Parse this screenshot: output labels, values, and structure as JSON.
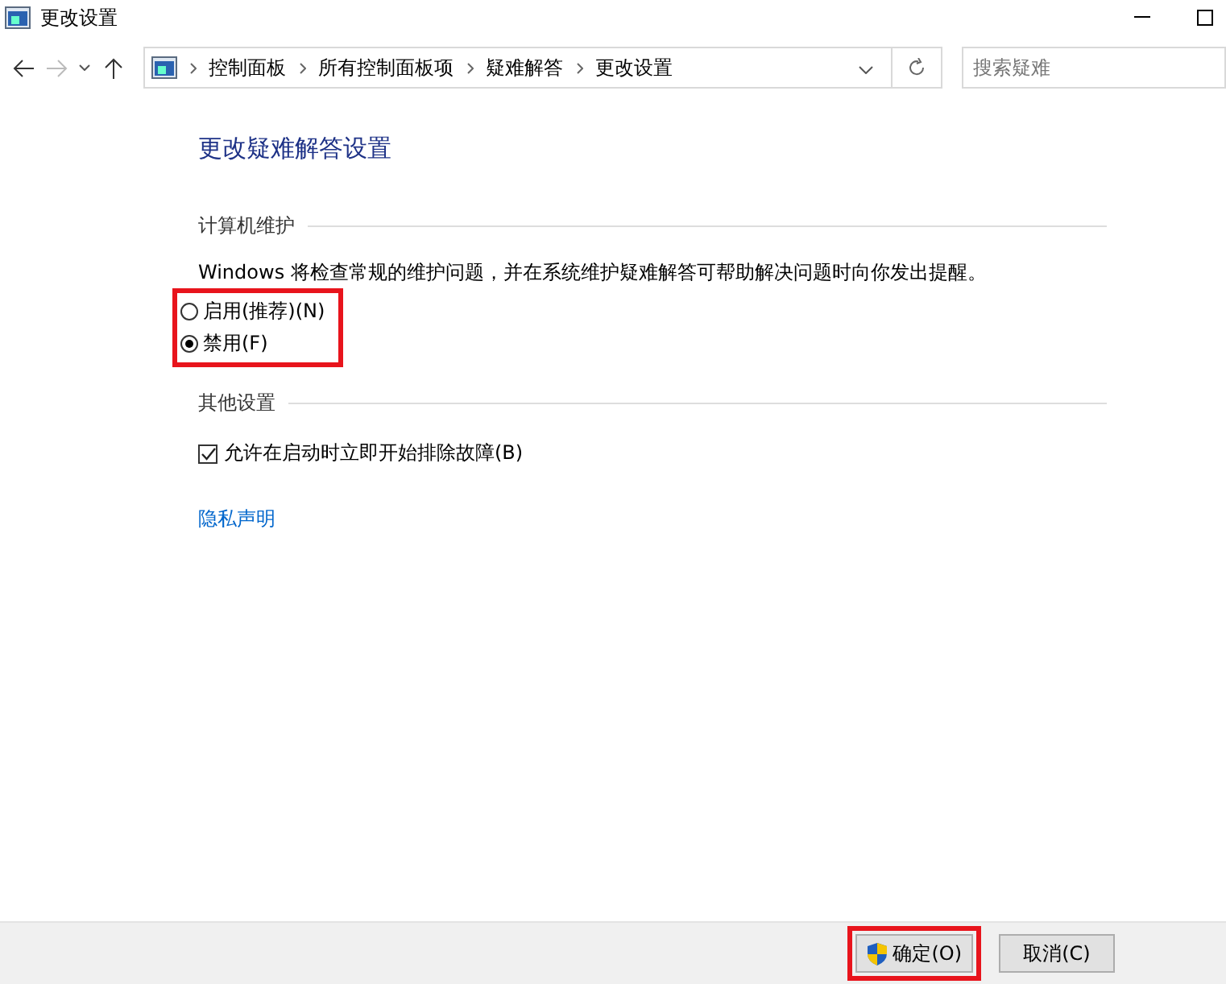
{
  "window": {
    "title": "更改设置"
  },
  "address_bar": {
    "crumbs": [
      "控制面板",
      "所有控制面板项",
      "疑难解答",
      "更改设置"
    ],
    "search_placeholder": "搜索疑难"
  },
  "heading": "更改疑难解答设置",
  "maintenance": {
    "title": "计算机维护",
    "description": "Windows 将检查常规的维护问题，并在系统维护疑难解答可帮助解决问题时向你发出提醒。",
    "highlighted": true,
    "options": [
      {
        "label": "启用(推荐)(N)",
        "selected": false
      },
      {
        "label": "禁用(F)",
        "selected": true
      }
    ]
  },
  "other": {
    "title": "其他设置",
    "checkbox": {
      "label": "允许在启动时立即开始排除故障(B)",
      "checked": true
    }
  },
  "privacy_link": "隐私声明",
  "buttons": [
    {
      "label": "确定(O)",
      "kind": "shield",
      "highlighted": true
    },
    {
      "label": "取消(C)",
      "kind": "plain",
      "highlighted": false
    }
  ]
}
